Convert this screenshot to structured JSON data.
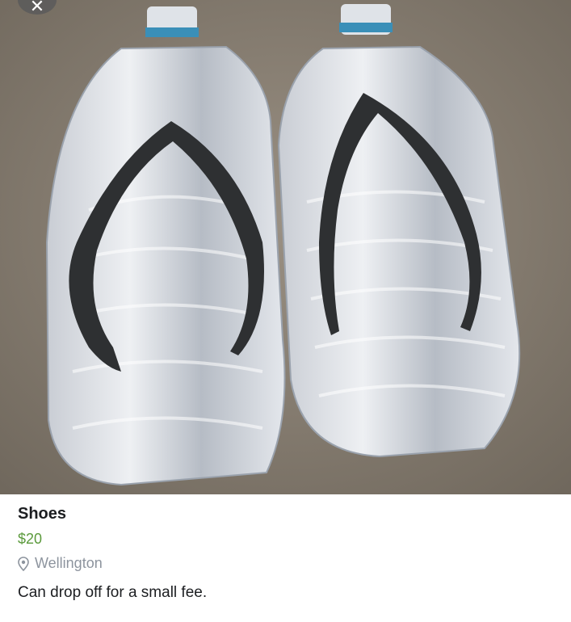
{
  "listing": {
    "title": "Shoes",
    "price": "$20",
    "location": "Wellington",
    "description": "Can drop off for a small fee."
  },
  "photo": {
    "subject-icon": "bottle-flip-flops-icon"
  },
  "icons": {
    "close": "close-icon",
    "location": "location-pin-icon"
  },
  "colors": {
    "price": "#5b9a3c",
    "location_text": "#8d949e",
    "title_text": "#1c1e21"
  }
}
